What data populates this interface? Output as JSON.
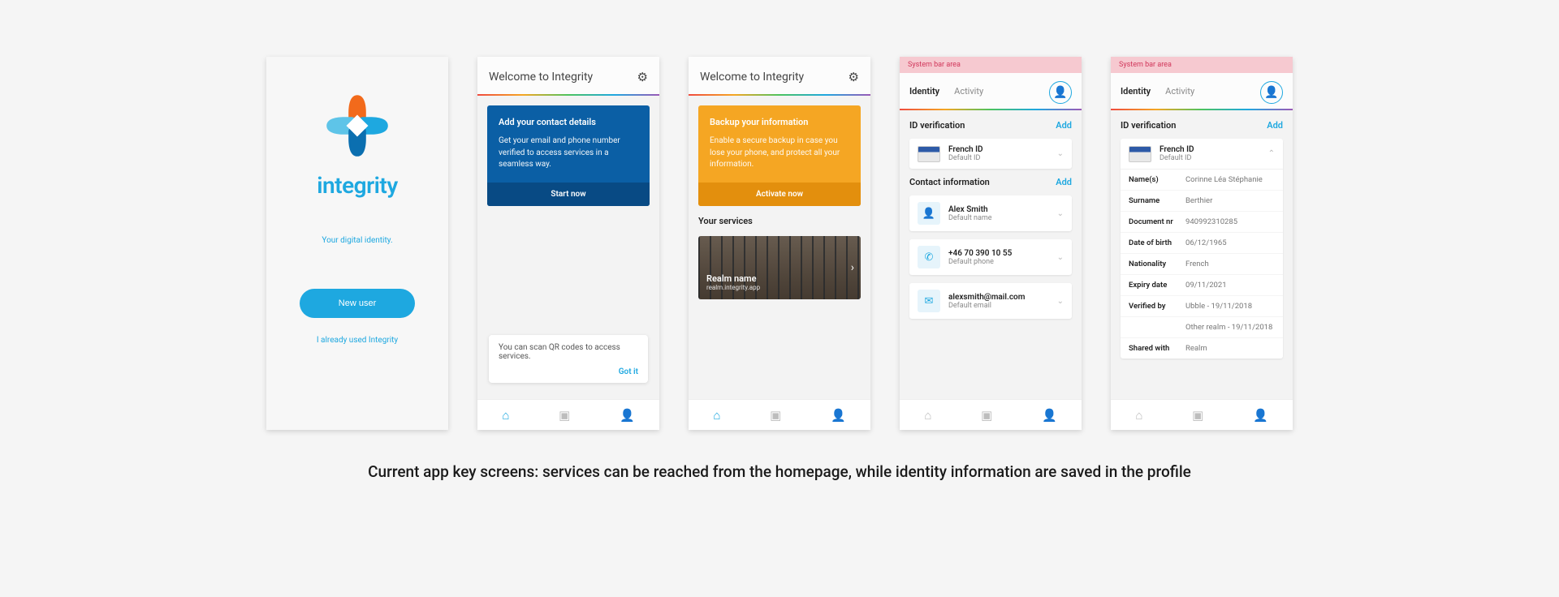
{
  "brand": {
    "name": "integrity",
    "tagline": "Your digital identity."
  },
  "s1": {
    "new_user_btn": "New user",
    "used_link": "I already used Integrity"
  },
  "s2": {
    "header_title": "Welcome to Integrity",
    "promo": {
      "title": "Add your contact details",
      "body": "Get your email and phone number verified to access services in a seamless way.",
      "action": "Start now"
    },
    "tooltip_text": "You can scan QR codes to access services.",
    "tooltip_action": "Got it"
  },
  "s3": {
    "header_title": "Welcome to Integrity",
    "promo": {
      "title": "Backup your information",
      "body": "Enable a secure backup in case you lose your phone, and protect all your information.",
      "action": "Activate now"
    },
    "services_label": "Your services",
    "realm": {
      "title": "Realm name",
      "subtitle": "realm.integrity.app"
    }
  },
  "s4": {
    "sysbar": "System bar area",
    "tabs": {
      "identity": "Identity",
      "activity": "Activity"
    },
    "id_section": "ID verification",
    "add": "Add",
    "id_card": {
      "title": "French ID",
      "sub": "Default ID"
    },
    "contact_section": "Contact information",
    "contacts": [
      {
        "icon": "user",
        "title": "Alex Smith",
        "sub": "Default name"
      },
      {
        "icon": "phone",
        "title": "+46 70 390 10 55",
        "sub": "Default phone"
      },
      {
        "icon": "mail",
        "title": "alexsmith@mail.com",
        "sub": "Default email"
      }
    ]
  },
  "s5": {
    "sysbar": "System bar area",
    "tabs": {
      "identity": "Identity",
      "activity": "Activity"
    },
    "id_section": "ID verification",
    "add": "Add",
    "id_card": {
      "title": "French ID",
      "sub": "Default ID"
    },
    "details": [
      {
        "k": "Name(s)",
        "v": "Corinne Léa Stéphanie"
      },
      {
        "k": "Surname",
        "v": "Berthier"
      },
      {
        "k": "Document nr",
        "v": "940992310285"
      },
      {
        "k": "Date of birth",
        "v": "06/12/1965"
      },
      {
        "k": "Nationality",
        "v": "French"
      },
      {
        "k": "Expiry date",
        "v": "09/11/2021"
      },
      {
        "k": "Verified by",
        "v": "Ubble - 19/11/2018"
      },
      {
        "k": "",
        "v": "Other realm - 19/11/2018",
        "sub": true
      },
      {
        "k": "Shared with",
        "v": "Realm"
      }
    ]
  },
  "caption": "Current app key screens: services can be reached from the homepage, while identity information are saved in the profile"
}
